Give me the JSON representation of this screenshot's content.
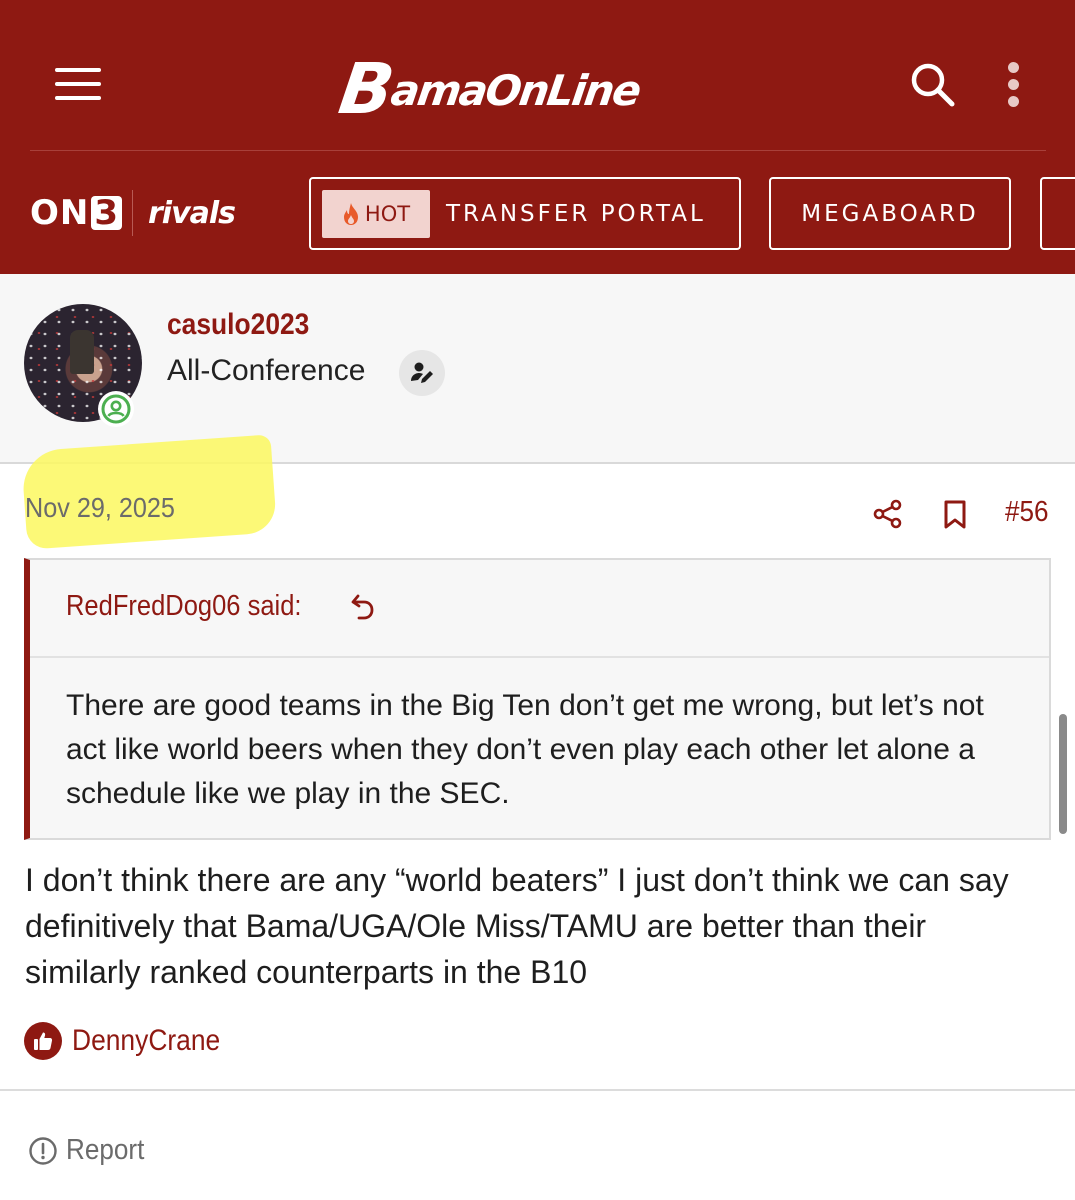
{
  "header": {
    "site_name_initial": "B",
    "site_name_rest": "amaOnLine",
    "network_brand": "ON",
    "network_brand_digit": "3",
    "partner_brand": "rivals",
    "nav_pills": [
      {
        "badge": "HOT",
        "label": "TRANSFER PORTAL"
      },
      {
        "label": "MEGABOARD"
      }
    ],
    "colors": {
      "brand": "#8e1912",
      "badge_bg": "#f2d3cf"
    }
  },
  "post": {
    "author": "casulo2023",
    "author_rank": "All-Conference",
    "date": "Nov 29, 2025",
    "post_number": "#56",
    "quote": {
      "author_said": "RedFredDog06 said:",
      "text": "There are good teams in the Big Ten don’t get me wrong, but let’s not act like world beers when they don’t even play each other let alone a schedule like we play in the SEC."
    },
    "message": "I don’t think there are any “world beaters” I just don’t think we can say definitively that Bama/UGA/Ole Miss/TAMU are better than their similarly ranked counterparts in the B10",
    "reaction_user": "DennyCrane",
    "report_label": "Report"
  }
}
